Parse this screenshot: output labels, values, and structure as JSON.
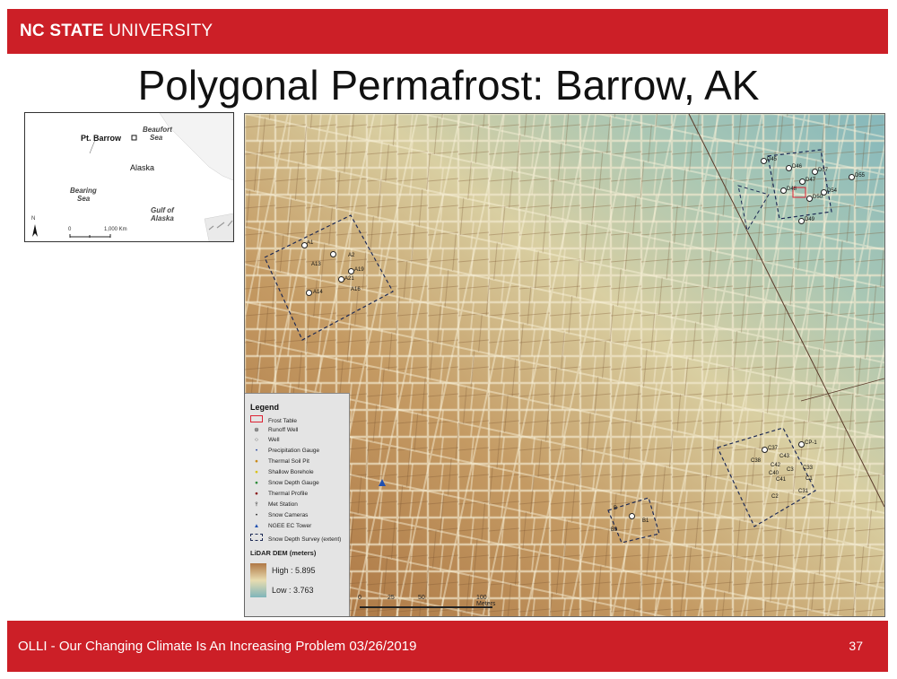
{
  "header": {
    "brand_bold": "NC STATE",
    "brand_light": " UNIVERSITY",
    "accent_color": "#cc1f27"
  },
  "slide": {
    "title": "Polygonal Permafrost: Barrow, AK",
    "footer": "OLLI - Our Changing Climate Is An Increasing Problem 03/26/2019",
    "page_number": "37"
  },
  "inset_map": {
    "labels": {
      "pt_barrow": "Pt. Barrow",
      "beaufort": "Beaufort",
      "sea1": "Sea",
      "alaska": "Alaska",
      "bearing": "Bearing",
      "sea2": "Sea",
      "gulf_of": "Gulf of",
      "alaska2": "Alaska",
      "north": "N",
      "scale_zero": "0",
      "scale_km": "1,000 Km"
    }
  },
  "map": {
    "site_labels": {
      "A1": "A1",
      "A2": "A2",
      "A13": "A13",
      "A19": "A19",
      "A21": "A21",
      "A14": "A14",
      "A16": "A16",
      "D45": "D45",
      "D46": "D46",
      "D57": "D57",
      "D55": "D55",
      "D47": "D47",
      "D48": "D48",
      "D54": "D54",
      "D50": "D50",
      "D49": "D49",
      "C37": "C37",
      "C43": "C43",
      "C38": "C38",
      "C42": "C42",
      "C3": "C3",
      "C33": "C33",
      "C1": "C1",
      "C31": "C31",
      "C2": "C2",
      "CP1": "CP-1",
      "C41": "C41",
      "C40": "C40",
      "B": "B",
      "B1": "B1",
      "B9": "B9"
    },
    "legend": {
      "title": "Legend",
      "items": [
        "Frost Table",
        "Runoff Well",
        "Well",
        "Precipitation Gauge",
        "Thermal Soil Pit",
        "Shallow Borehole",
        "Snow Depth Gauge",
        "Thermal Profile",
        "Met Station",
        "Snow Cameras",
        "NGEE EC Tower",
        "Snow Depth Survey (extent)"
      ],
      "lidar_title": "LiDAR DEM (meters)",
      "high": "High : 5.895",
      "low": "Low : 3.763"
    },
    "scale_bar": {
      "t0": "0",
      "t25": "25",
      "t50": "50",
      "t100": "100 Meters"
    }
  }
}
